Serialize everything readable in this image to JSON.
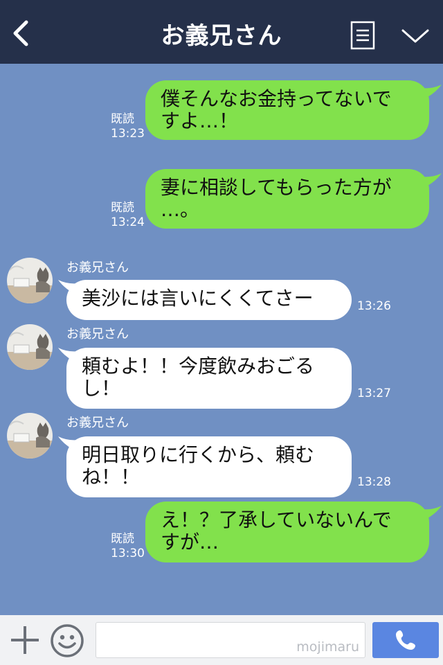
{
  "header": {
    "title": "お義兄さん",
    "icons": {
      "back": "chevron-left-icon",
      "menu": "menu-icon",
      "collapse": "chevron-down-icon"
    }
  },
  "messages": [
    {
      "side": "sent",
      "text": "僕そんなお金持ってないで\nすよ…！",
      "read": "既読",
      "time": "13:23"
    },
    {
      "side": "sent",
      "text": "妻に相談してもらった方が\n…。",
      "read": "既読",
      "time": "13:24"
    },
    {
      "side": "received",
      "sender": "お義兄さん",
      "text": "美沙には言いにくくてさー",
      "time": "13:26"
    },
    {
      "side": "received",
      "sender": "お義兄さん",
      "text": "頼むよ！！今度飲みおごる\nし！",
      "time": "13:27"
    },
    {
      "side": "received",
      "sender": "お義兄さん",
      "text": "明日取りに行くから、頼む\nね！！",
      "time": "13:28"
    },
    {
      "side": "sent",
      "text": "え！？了承していないんで\nすが…",
      "read": "既読",
      "time": "13:30"
    }
  ],
  "footer": {
    "watermark": "mojimaru",
    "icons": {
      "add": "plus-icon",
      "sticker": "smiley-icon",
      "call": "phone-icon"
    }
  },
  "colors": {
    "header_bg": "#25304a",
    "chat_bg": "#7090c3",
    "sent_bubble": "#82e14c",
    "received_bubble": "#ffffff",
    "call_button": "#5a86e1"
  }
}
